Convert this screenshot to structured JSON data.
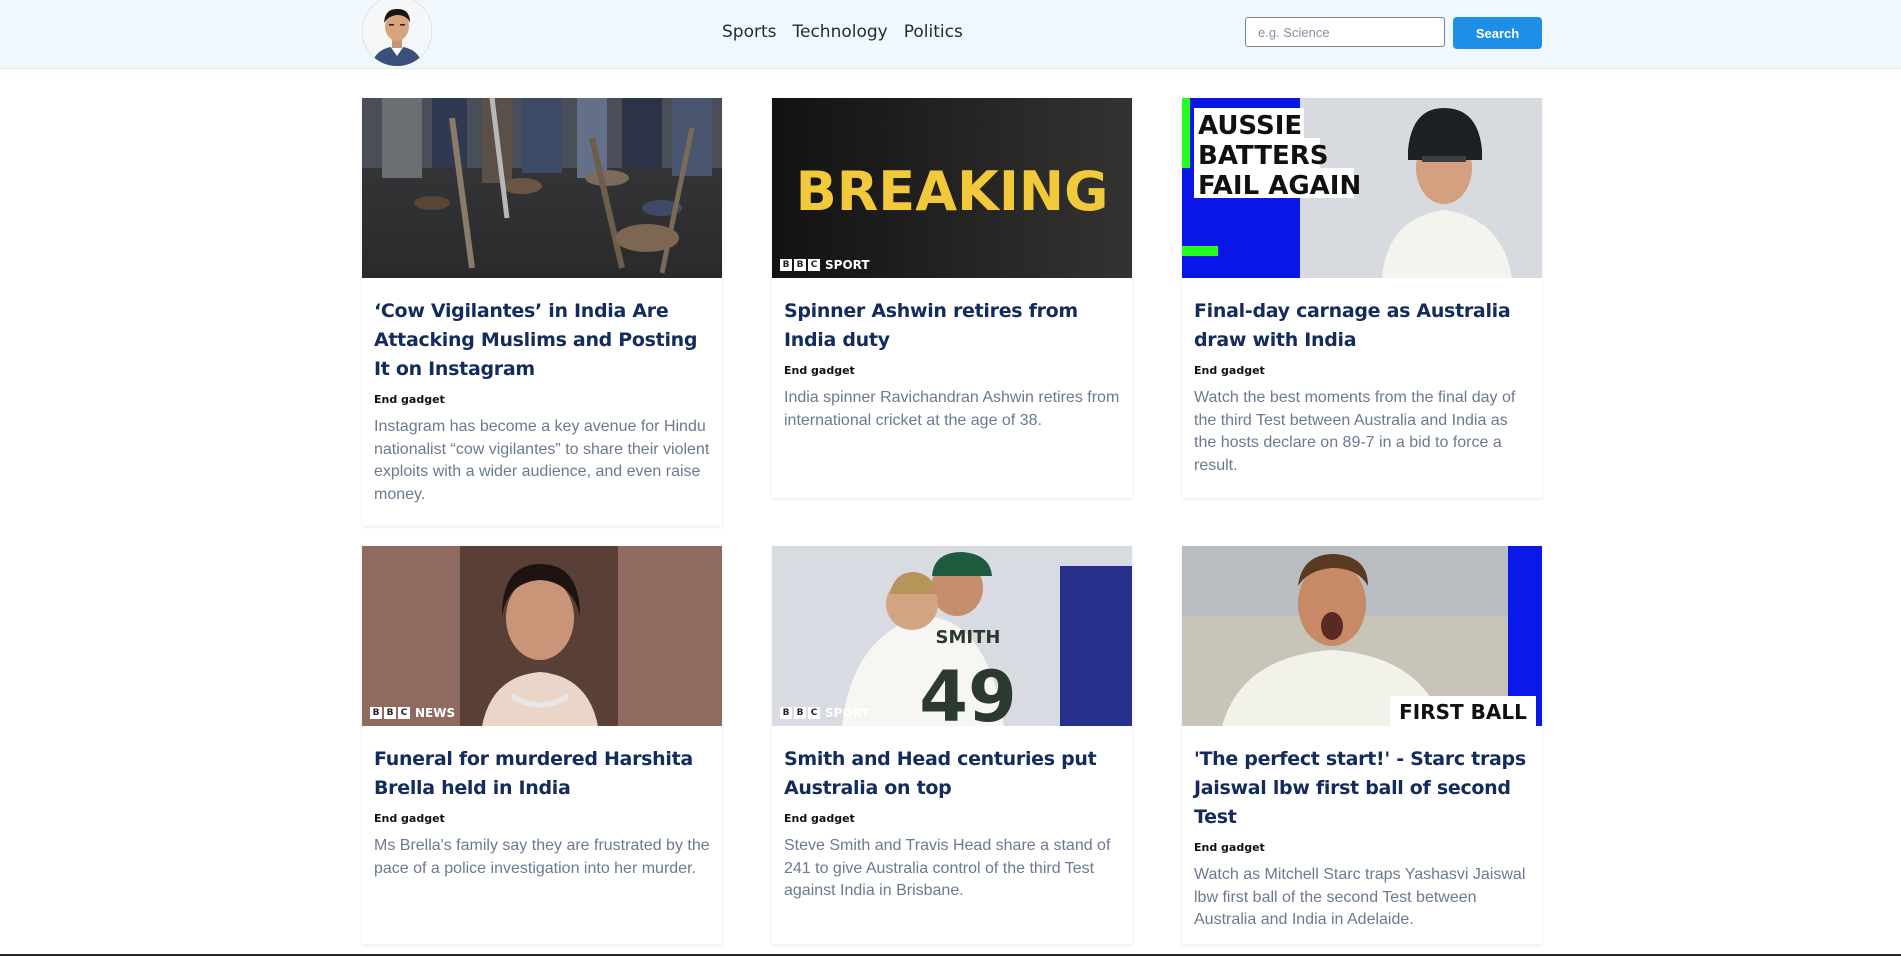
{
  "nav": {
    "links": [
      "Sports",
      "Technology",
      "Politics"
    ],
    "search_placeholder": "e.g. Science",
    "search_value": "",
    "search_button": "Search"
  },
  "cards": [
    {
      "title": "‘Cow Vigilantes’ in India Are Attacking Muslims and Posting It on Instagram",
      "source": "End gadget",
      "description": "Instagram has become a key avenue for Hindu nationalist “cow vigilantes” to share their violent exploits with a wider audience, and even raise money."
    },
    {
      "title": "Spinner Ashwin retires from India duty",
      "source": "End gadget",
      "description": "India spinner Ravichandran Ashwin retires from international cricket at the age of 38.",
      "image_text": "BREAKING",
      "image_brand": "SPORT"
    },
    {
      "title": "Final-day carnage as Australia draw with India",
      "source": "End gadget",
      "description": "Watch the best moments from the final day of the third Test between Australia and India as the hosts declare on 89-7 in a bid to force a result.",
      "image_text": [
        "AUSSIE",
        "BATTERS",
        "FAIL AGAIN"
      ]
    },
    {
      "title": "Funeral for murdered Harshita Brella held in India",
      "source": "End gadget",
      "description": "Ms Brella's family say they are frustrated by the pace of a police investigation into her murder.",
      "image_brand": "NEWS"
    },
    {
      "title": "Smith and Head centuries put Australia on top",
      "source": "End gadget",
      "description": "Steve Smith and Travis Head share a stand of 241 to give Australia control of the third Test against India in Brisbane.",
      "image_brand": "SPORT",
      "image_text": [
        "SMITH",
        "49"
      ]
    },
    {
      "title": "'The perfect start!' - Starc traps Jaiswal lbw first ball of second Test",
      "source": "End gadget",
      "description": "Watch as Mitchell Starc traps Yashasvi Jaiswal lbw first ball of the second Test between Australia and India in Adelaide.",
      "image_text": "FIRST BALL"
    }
  ],
  "colors": {
    "navbar_bg": "#f0f8fe",
    "accent": "#1e8fe8",
    "title": "#142c5c",
    "description": "#6b7a90"
  }
}
